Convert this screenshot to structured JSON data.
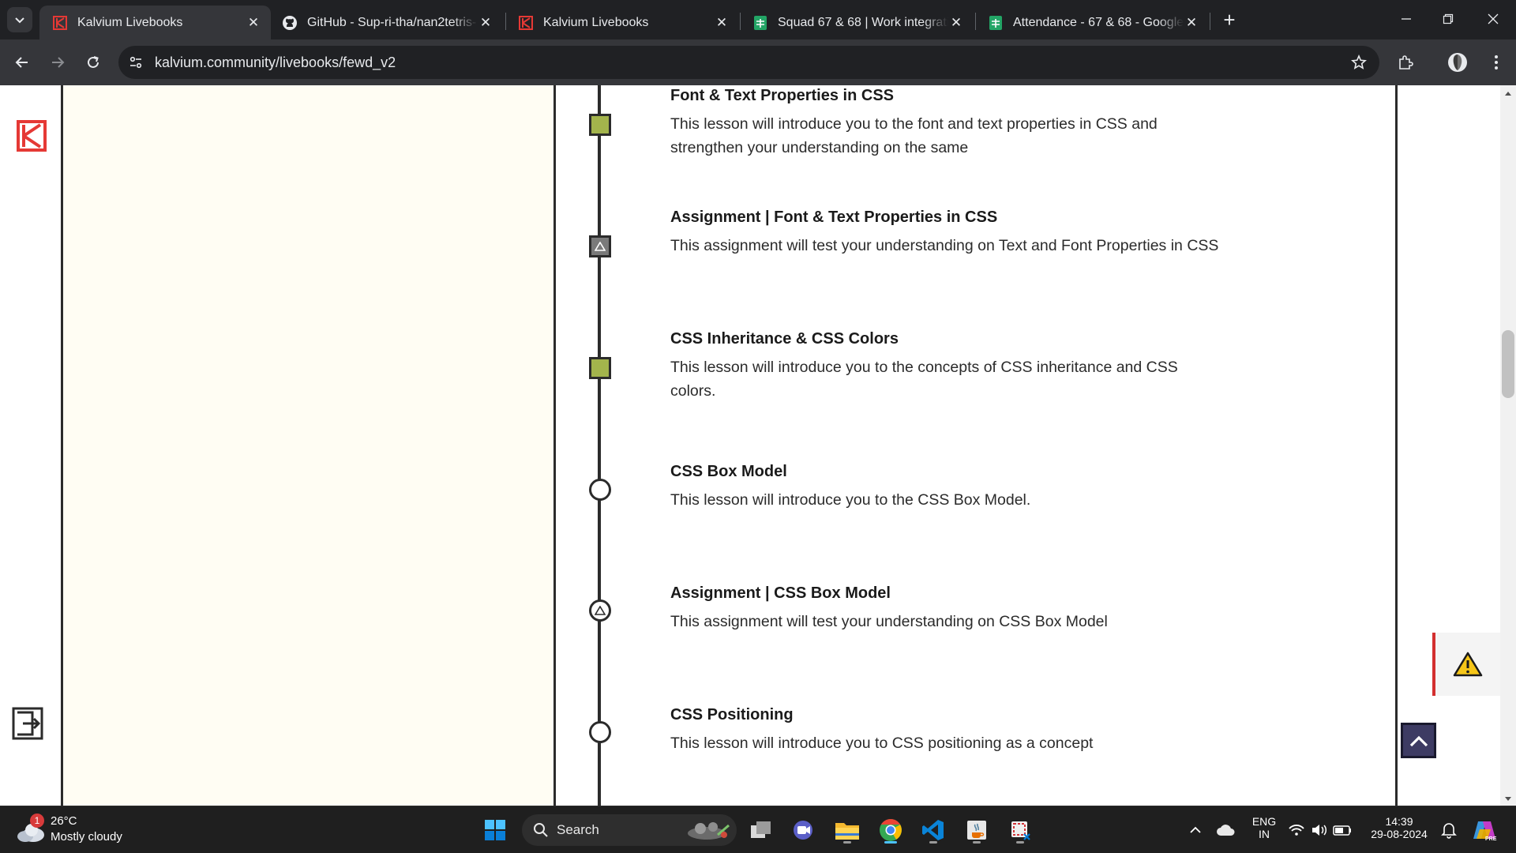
{
  "browser": {
    "tabs": [
      {
        "title": "Kalvium Livebooks",
        "active": true,
        "favicon": "kalvium-icon"
      },
      {
        "title": "GitHub - Sup-ri-tha/nan2tetris-",
        "active": false,
        "favicon": "github-icon"
      },
      {
        "title": "Kalvium Livebooks",
        "active": false,
        "favicon": "kalvium-icon"
      },
      {
        "title": "Squad 67 & 68 | Work integratio",
        "active": false,
        "favicon": "sheets-icon"
      },
      {
        "title": "Attendance - 67 & 68 - Google",
        "active": false,
        "favicon": "sheets-icon"
      }
    ],
    "url": "kalvium.community/livebooks/fewd_v2"
  },
  "course": {
    "items": [
      {
        "title": "Font & Text Properties in CSS",
        "description": "This lesson will introduce you to the font and text properties in CSS and strengthen your understanding on the same",
        "kind": "lesson",
        "status": "completed"
      },
      {
        "title": "Assignment | Font & Text Properties in CSS",
        "description": "This assignment will test your understanding on Text and Font Properties in CSS",
        "kind": "assignment",
        "status": "completed"
      },
      {
        "title": "CSS Inheritance & CSS Colors",
        "description": "This lesson will introduce you to the concepts of CSS inheritance and CSS colors.",
        "kind": "lesson",
        "status": "completed"
      },
      {
        "title": "CSS Box Model",
        "description": "This lesson will introduce you to the CSS Box Model.",
        "kind": "lesson",
        "status": "pending"
      },
      {
        "title": "Assignment | CSS Box Model",
        "description": "This assignment will test your understanding on CSS Box Model",
        "kind": "assignment",
        "status": "pending"
      },
      {
        "title": "CSS Positioning",
        "description": "This lesson will introduce you to CSS positioning as a concept",
        "kind": "lesson",
        "status": "pending"
      }
    ]
  },
  "colors": {
    "completed_node": "#a3b44c",
    "assignment_node": "#7a7a7a",
    "brand_red": "#e53935",
    "scroll_top_button": "#3d3b63"
  },
  "taskbar": {
    "weather": {
      "temp": "26°C",
      "condition": "Mostly cloudy",
      "badge": "1"
    },
    "search_label": "Search",
    "language": {
      "line1": "ENG",
      "line2": "IN"
    },
    "clock": {
      "time": "14:39",
      "date": "29-08-2024"
    }
  }
}
